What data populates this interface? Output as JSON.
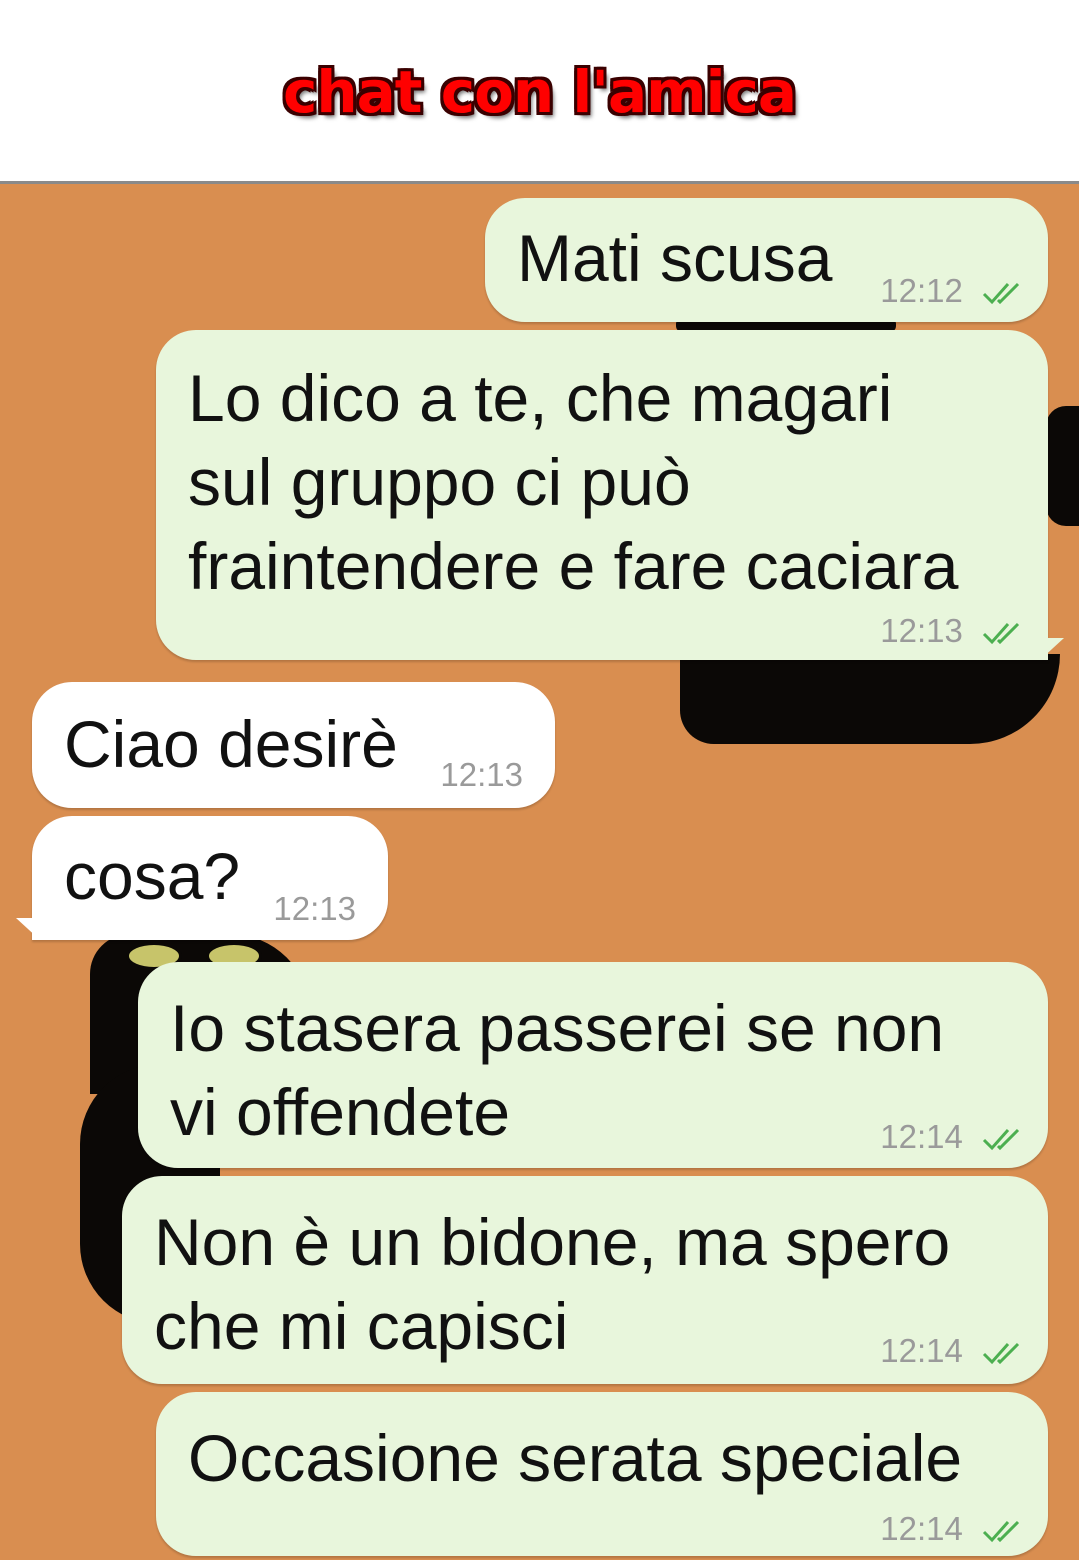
{
  "header": {
    "title": "chat con l'amica"
  },
  "colors": {
    "header_title": "#ff0000",
    "chat_background": "#d98e50",
    "outgoing_bubble": "#e8f6dc",
    "incoming_bubble": "#ffffff",
    "read_ticks": "#4caf50"
  },
  "messages": [
    {
      "direction": "out",
      "text": "Mati scusa",
      "time": "12:12",
      "status": "read"
    },
    {
      "direction": "out",
      "text": "Lo dico a te, che magari\nsul gruppo ci può\nfraintendere e fare caciara",
      "time": "12:13",
      "status": "read"
    },
    {
      "direction": "in",
      "text": "Ciao desirè",
      "time": "12:13"
    },
    {
      "direction": "in",
      "text": "cosa?",
      "time": "12:13"
    },
    {
      "direction": "out",
      "text": "Io stasera passerei se non\nvi offendete",
      "time": "12:14",
      "status": "read"
    },
    {
      "direction": "out",
      "text": "Non è un bidone, ma spero\nche mi capisci",
      "time": "12:14",
      "status": "read"
    },
    {
      "direction": "out",
      "text": "Occasione serata speciale",
      "time": "12:14",
      "status": "read"
    }
  ]
}
